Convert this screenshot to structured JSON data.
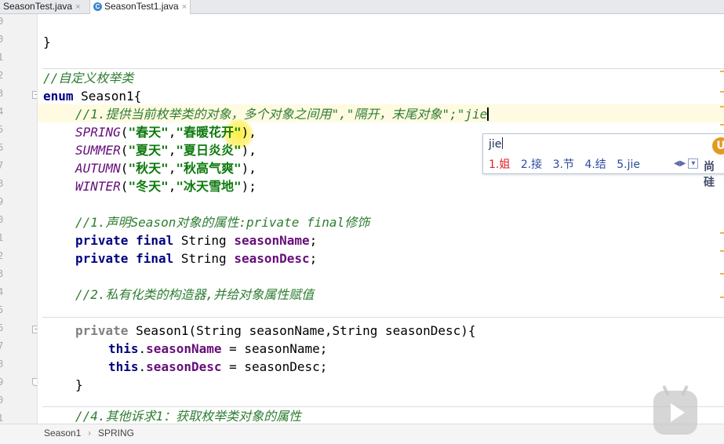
{
  "tabs": [
    {
      "label": "SeasonTest.java",
      "close": "×",
      "active": false
    },
    {
      "label": "SeasonTest1.java",
      "close": "×",
      "active": true,
      "icon_letter": "C"
    }
  ],
  "gutter": {
    "line_numbers": [
      "0",
      "0",
      "1",
      "2",
      "3",
      "4",
      "5",
      "6",
      "7",
      "8",
      "9",
      "0",
      "1",
      "2",
      "3",
      "4",
      "5",
      "6",
      "7",
      "8",
      "9",
      "0",
      "1",
      "2"
    ]
  },
  "code": {
    "close_brace_top": "}",
    "comment_enum": "//自定义枚举类",
    "kw_enum": "enum",
    "enum_name": "Season1{",
    "comment_provide": "//1.提供当前枚举类的对象，多个对象之间用\",\"隔开，末尾对象\";\"jie",
    "constants": [
      {
        "name": "SPRING",
        "a": "\"春天\"",
        "b": "\"春暖花开\"",
        "end": "),"
      },
      {
        "name": "SUMMER",
        "a": "\"夏天\"",
        "b": "\"夏日炎炎\"",
        "end": "),"
      },
      {
        "name": "AUTUMN",
        "a": "\"秋天\"",
        "b": "\"秋高气爽\"",
        "end": "),"
      },
      {
        "name": "WINTER",
        "a": "\"冬天\"",
        "b": "\"冰天雪地\"",
        "end": ");"
      }
    ],
    "comment_declare": "//1.声明Season对象的属性:private final修饰",
    "kw_private": "private",
    "kw_final": "final",
    "type_string": "String",
    "field_name": "seasonName",
    "field_desc": "seasonDesc",
    "comment_ctor": "//2.私有化类的构造器,并给对象属性赋值",
    "ctor_signature": "Season1(String seasonName,String seasonDesc){",
    "kw_this": "this",
    "assign_name": " = seasonName;",
    "assign_desc": " = seasonDesc;",
    "close_brace": "}",
    "comment_other": "//4.其他诉求1：获取枚举类对象的属性"
  },
  "ime": {
    "input": "jie",
    "candidates": [
      "1.姐",
      "2.接",
      "3.节",
      "4.结",
      "5.jie"
    ],
    "logo_letter": "U",
    "brand": "尚硅"
  },
  "breadcrumb": {
    "items": [
      "Season1",
      "SPRING"
    ],
    "separator": "›"
  },
  "colors": {
    "keyword": "#000080",
    "comment": "#2e7d32",
    "string": "#0d7a0d",
    "field": "#660e7a",
    "current_line": "#fffbe2"
  }
}
